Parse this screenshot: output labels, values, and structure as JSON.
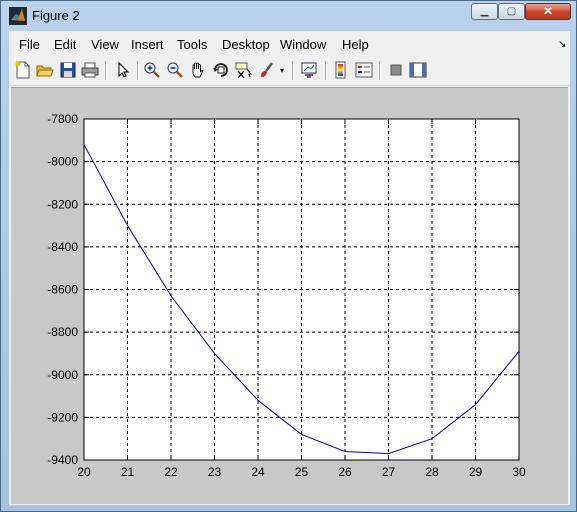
{
  "window": {
    "title": "Figure 2"
  },
  "window_buttons": {
    "minimize": "▁",
    "maximize": "▢",
    "close": "✕"
  },
  "menu": {
    "items": [
      {
        "label": "File"
      },
      {
        "label": "Edit"
      },
      {
        "label": "View"
      },
      {
        "label": "Insert"
      },
      {
        "label": "Tools"
      },
      {
        "label": "Desktop"
      },
      {
        "label": "Window"
      },
      {
        "label": "Help"
      }
    ]
  },
  "toolbar": {
    "icons": [
      "new-figure-icon",
      "open-file-icon",
      "save-icon",
      "print-icon",
      "select-arrow-icon",
      "zoom-in-icon",
      "zoom-out-icon",
      "pan-hand-icon",
      "rotate-3d-icon",
      "data-cursor-icon",
      "brush-icon",
      "link-plot-icon",
      "colorbar-icon",
      "legend-icon",
      "hide-plot-tools-icon",
      "show-plot-tools-icon"
    ]
  },
  "colors": {
    "line": "#0000a8",
    "axes_bg": "#ffffff",
    "figure_bg": "#c8c8c8"
  },
  "chart_data": {
    "type": "line",
    "title": "",
    "xlabel": "",
    "ylabel": "",
    "xlim": [
      20,
      30
    ],
    "ylim": [
      -9400,
      -7800
    ],
    "grid": true,
    "grid_style": "dashed",
    "xticks": [
      20,
      21,
      22,
      23,
      24,
      25,
      26,
      27,
      28,
      29,
      30
    ],
    "yticks": [
      -7800,
      -8000,
      -8200,
      -8400,
      -8600,
      -8800,
      -9000,
      -9200,
      -9400
    ],
    "series": [
      {
        "x": [
          20,
          21,
          22,
          23,
          24,
          25,
          26,
          27,
          28,
          29,
          30
        ],
        "y": [
          -7920,
          -8300,
          -8630,
          -8900,
          -9120,
          -9280,
          -9360,
          -9370,
          -9300,
          -9140,
          -8890
        ]
      }
    ]
  }
}
